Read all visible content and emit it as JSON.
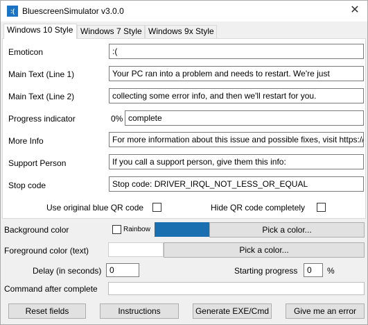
{
  "window": {
    "app_icon_text": ":(",
    "title": "BluescreenSimulator v3.0.0",
    "close_glyph": "✕"
  },
  "tabs": [
    {
      "label": "Windows 10 Style",
      "active": true
    },
    {
      "label": "Windows 7 Style",
      "active": false
    },
    {
      "label": "Windows 9x Style",
      "active": false
    }
  ],
  "fields": {
    "emoticon": {
      "label": "Emoticon",
      "value": ":("
    },
    "main_text_1": {
      "label": "Main Text (Line 1)",
      "value": "Your PC ran into a problem and needs to restart. We're just"
    },
    "main_text_2": {
      "label": "Main Text (Line 2)",
      "value": "collecting some error info, and then we'll restart for you."
    },
    "progress": {
      "label": "Progress indicator",
      "prefix": "0%",
      "value": "complete"
    },
    "more_info": {
      "label": "More Info",
      "value": "For more information about this issue and possible fixes, visit https://"
    },
    "support_person": {
      "label": "Support Person",
      "value": "If you call a support person, give them this info:"
    },
    "stop_code": {
      "label": "Stop code",
      "value": "Stop code: DRIVER_IRQL_NOT_LESS_OR_EQUAL"
    }
  },
  "qr": {
    "use_original_label": "Use original blue QR code",
    "use_original_checked": false,
    "hide_label": "Hide QR code completely",
    "hide_checked": false
  },
  "colors": {
    "background_label": "Background color",
    "rainbow_label": "Rainbow",
    "rainbow_checked": false,
    "background_value": "#1a6fb0",
    "background_pick_label": "Pick a color...",
    "foreground_label": "Foreground color (text)",
    "foreground_value": "#ffffff",
    "foreground_pick_label": "Pick a color..."
  },
  "delay": {
    "label": "Delay (in seconds)",
    "value": "0"
  },
  "starting_progress": {
    "label": "Starting progress",
    "value": "0",
    "unit": "%"
  },
  "command": {
    "label": "Command after complete",
    "value": ""
  },
  "buttons": {
    "reset": "Reset fields",
    "instructions": "Instructions",
    "generate": "Generate EXE/Cmd",
    "error": "Give me an error"
  }
}
